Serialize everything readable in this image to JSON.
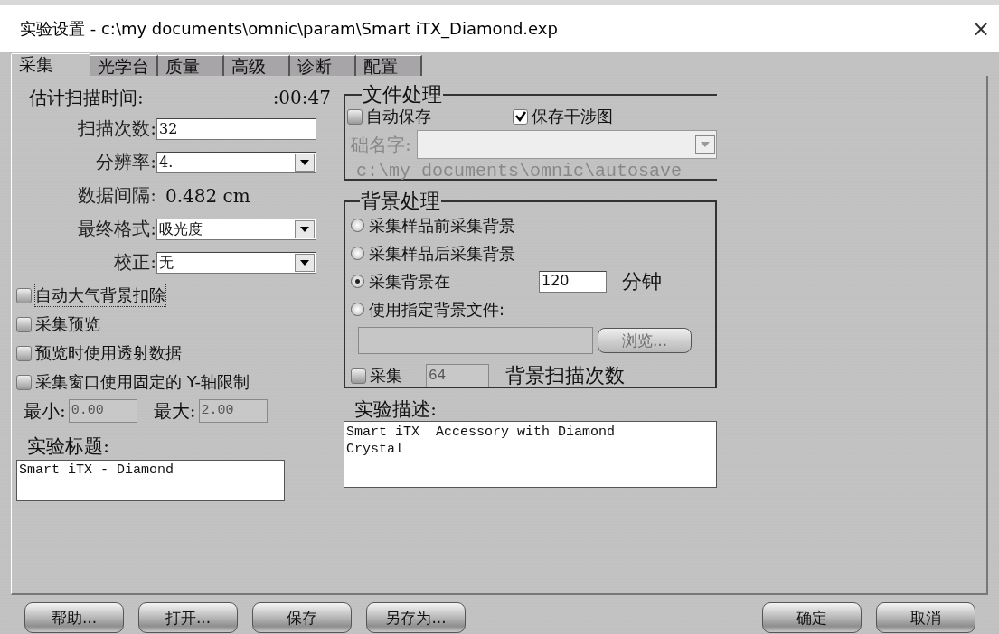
{
  "window": {
    "title": "实验设置 - c:\\my documents\\omnic\\param\\Smart iTX_Diamond.exp",
    "close": "×"
  },
  "tabs": [
    {
      "label": "采集",
      "selected": true
    },
    {
      "label": "光学台",
      "selected": false
    },
    {
      "label": "质量",
      "selected": false
    },
    {
      "label": "高级",
      "selected": false
    },
    {
      "label": "诊断",
      "selected": false
    },
    {
      "label": "配置",
      "selected": false
    }
  ],
  "collect": {
    "scan_time": {
      "label": "估计扫描时间:",
      "value": ":00:47"
    },
    "fields": [
      {
        "kind": "input",
        "label": "扫描次数:",
        "value": "32"
      },
      {
        "kind": "select",
        "label": "分辨率:",
        "value": "4."
      },
      {
        "kind": "readout",
        "label": "数据间隔:",
        "value": "0.482 cm"
      },
      {
        "kind": "select",
        "label": "最终格式:",
        "value": "吸光度"
      },
      {
        "kind": "select",
        "label": "校正:",
        "value": "无"
      }
    ],
    "checkboxes": [
      {
        "label": "自动大气背景扣除",
        "checked": false,
        "focused": true
      },
      {
        "label": "采集预览",
        "checked": false,
        "focused": false
      },
      {
        "label": "预览时使用透射数据",
        "checked": false,
        "focused": false
      },
      {
        "label": "采集窗口使用固定的 Y-轴限制",
        "checked": false,
        "focused": false
      }
    ],
    "limits": {
      "min_label": "最小:",
      "min_value": "0.00",
      "max_label": "最大:",
      "max_value": "2.00"
    },
    "title_label": "实验标题:",
    "title_value": "Smart iTX - Diamond"
  },
  "file_handling": {
    "legend": "文件处理",
    "checkboxes": [
      {
        "label": "自动保存",
        "checked": false
      },
      {
        "label": "保存干涉图",
        "checked": true
      }
    ],
    "base_name_label": "础名字:",
    "path": "c:\\my documents\\omnic\\autosave"
  },
  "background": {
    "legend": "背景处理",
    "options": [
      {
        "label": "采集样品前采集背景",
        "selected": false
      },
      {
        "label": "采集样品后采集背景",
        "selected": false
      },
      {
        "label": "采集背景在",
        "selected": true,
        "value": "120",
        "unit": "分钟"
      },
      {
        "label": "使用指定背景文件:",
        "selected": false
      }
    ],
    "browse": "浏览...",
    "scans": {
      "label": "采集",
      "checked": false,
      "value": "64",
      "suffix": "背景扫描次数"
    }
  },
  "description": {
    "label": "实验描述:",
    "lines": [
      "Smart iTX  Accessory with Diamond",
      "Crystal"
    ]
  },
  "buttons_left": [
    "帮助...",
    "打开...",
    "保存",
    "另存为..."
  ],
  "buttons_right": [
    "确定",
    "取消"
  ]
}
